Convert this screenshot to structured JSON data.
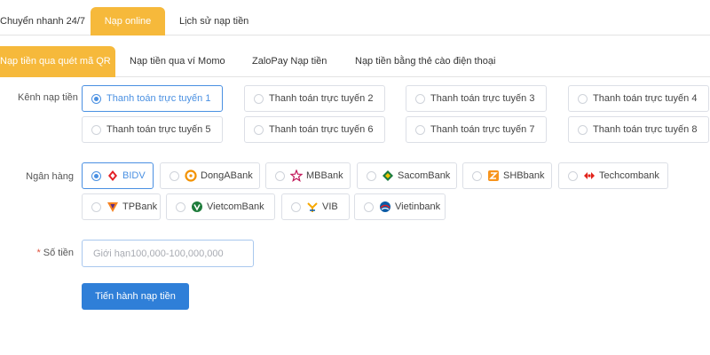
{
  "top_tabs": [
    {
      "label": "Chuyển nhanh 24/7"
    },
    {
      "label": "Nạp online"
    },
    {
      "label": "Lịch sử nạp tiền"
    }
  ],
  "sub_tabs": [
    {
      "label": "Nạp tiền qua quét mã QR"
    },
    {
      "label": "Nạp tiền qua ví Momo"
    },
    {
      "label": "ZaloPay Nạp tiền"
    },
    {
      "label": "Nạp tiền bằng thẻ cào điện thoại"
    }
  ],
  "channel": {
    "label": "Kênh nạp tiền",
    "selected": "Thanh toán trực tuyến 1",
    "options": [
      "Thanh toán trực tuyến 1",
      "Thanh toán trực tuyến 2",
      "Thanh toán trực tuyến 3",
      "Thanh toán trực tuyến 4",
      "Thanh toán trực tuyến 5",
      "Thanh toán trực tuyến 6",
      "Thanh toán trực tuyến 7",
      "Thanh toán trực tuyến 8"
    ]
  },
  "bank": {
    "label": "Ngân hàng",
    "selected": "BIDV",
    "options": [
      {
        "name": "BIDV",
        "icon": "bidv-logo-icon",
        "color": "#e31e24"
      },
      {
        "name": "DongABank",
        "icon": "donga-logo-icon",
        "color": "#f39200"
      },
      {
        "name": "MBBank",
        "icon": "mbbank-logo-icon",
        "color": "#c2185b"
      },
      {
        "name": "SacomBank",
        "icon": "sacombank-logo-icon",
        "color": "#1b7c3e"
      },
      {
        "name": "SHBbank",
        "icon": "shb-logo-icon",
        "color": "#f7941d"
      },
      {
        "name": "Techcombank",
        "icon": "techcombank-logo-icon",
        "color": "#e2231a"
      },
      {
        "name": "TPBank",
        "icon": "tpbank-logo-icon",
        "color": "#f58220"
      },
      {
        "name": "VietcomBank",
        "icon": "vietcombank-logo-icon",
        "color": "#1e7c3b"
      },
      {
        "name": "VIB",
        "icon": "vib-logo-icon",
        "color": "#f6a800"
      },
      {
        "name": "Vietinbank",
        "icon": "vietinbank-logo-icon",
        "color": "#0b5ba5"
      }
    ]
  },
  "amount": {
    "required_mark": "*",
    "label": "Số tiền",
    "value": "",
    "placeholder": "Giới hạn100,000-100,000,000"
  },
  "submit": {
    "label": "Tiến hành nạp tiền"
  },
  "colors": {
    "accent_tab": "#f6b93b",
    "primary": "#2f7fd8",
    "selected": "#4a90e2"
  }
}
